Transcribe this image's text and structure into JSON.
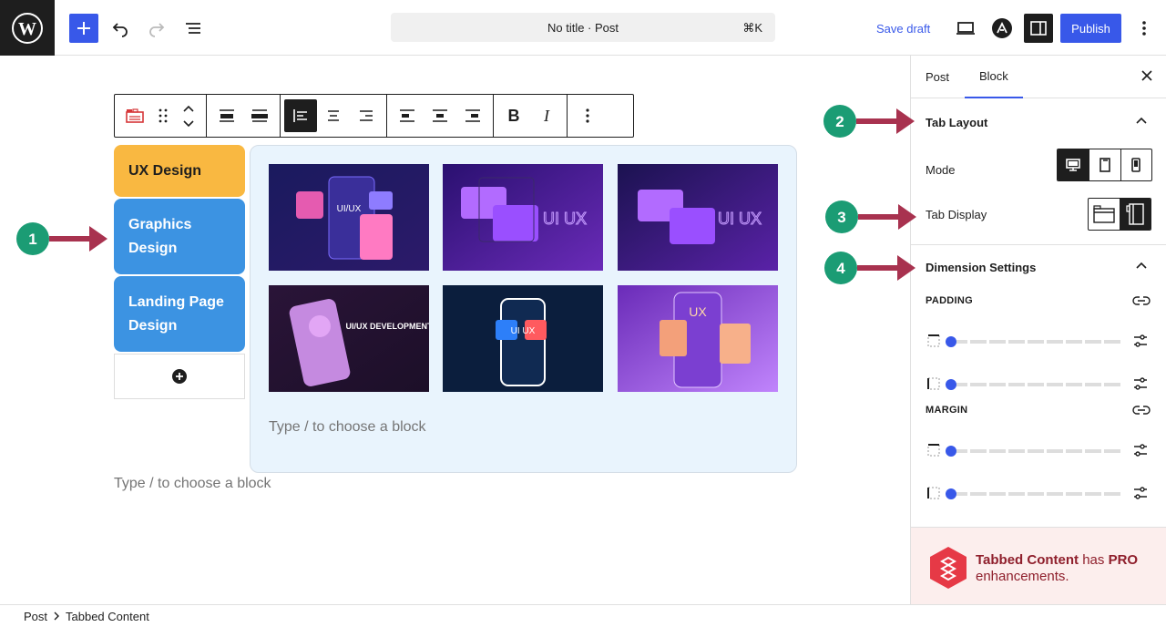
{
  "header": {
    "doc_title": "No title · Post",
    "shortcut": "⌘K",
    "save_draft": "Save draft",
    "publish": "Publish",
    "accent": "#3858e9"
  },
  "tabs": [
    {
      "label": "UX Design",
      "color": "#f9b841"
    },
    {
      "label": "Graphics Design",
      "color": "#3c93e2"
    },
    {
      "label": "Landing Page Design",
      "color": "#3c93e2"
    }
  ],
  "images": [
    {
      "caption": "UI/UX"
    },
    {
      "caption": "UI UX"
    },
    {
      "caption": "UI UX"
    },
    {
      "caption": "UI/UX DEVELOPMENT"
    },
    {
      "caption": "UI UX"
    },
    {
      "caption": "UX"
    }
  ],
  "editor": {
    "placeholder_inner": "Type / to choose a block",
    "placeholder_outer": "Type / to choose a block"
  },
  "callouts": [
    "1",
    "2",
    "3",
    "4"
  ],
  "sidebar": {
    "tabs": [
      "Post",
      "Block"
    ],
    "tab_layout": "Tab Layout",
    "mode": "Mode",
    "tab_display": "Tab Display",
    "dimension_settings": "Dimension Settings",
    "padding": "PADDING",
    "margin": "MARGIN",
    "sliders": {
      "padding_top": 0,
      "padding_bottom": 0,
      "margin_top": 0,
      "margin_bottom": 0
    }
  },
  "pro": {
    "name": "Tabbed Content",
    "has": " has ",
    "pro": "PRO",
    "rest": "enhancements."
  },
  "breadcrumb": [
    "Post",
    "Tabbed Content"
  ]
}
